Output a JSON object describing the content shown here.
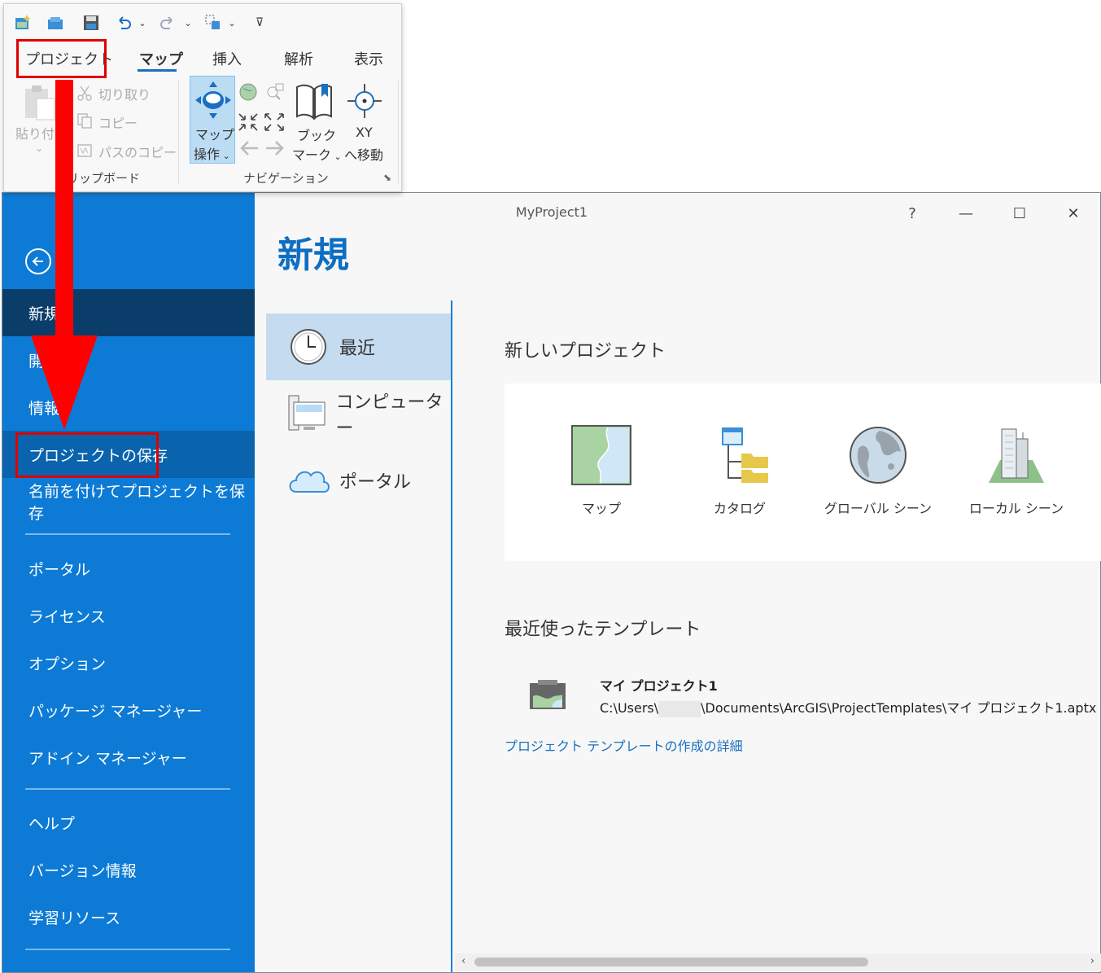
{
  "window": {
    "title": "MyProject1",
    "help": "?",
    "minimize": "—",
    "maximize": "☐",
    "close": "✕"
  },
  "heading": "新規",
  "sidebar": {
    "items": [
      {
        "label": "新規"
      },
      {
        "label": "開く"
      },
      {
        "label": "情報"
      },
      {
        "label": "プロジェクトの保存"
      },
      {
        "label": "名前を付けてプロジェクトを保存"
      },
      {
        "label": "ポータル"
      },
      {
        "label": "ライセンス"
      },
      {
        "label": "オプション"
      },
      {
        "label": "パッケージ マネージャー"
      },
      {
        "label": "アドイン マネージャー"
      },
      {
        "label": "ヘルプ"
      },
      {
        "label": "バージョン情報"
      },
      {
        "label": "学習リソース"
      }
    ]
  },
  "locations": [
    {
      "label": "最近",
      "icon": "clock-icon"
    },
    {
      "label": "コンピューター",
      "icon": "computer-icon"
    },
    {
      "label": "ポータル",
      "icon": "cloud-icon"
    }
  ],
  "new_project": {
    "title": "新しいプロジェクト",
    "items": [
      {
        "label": "マップ",
        "icon": "map-icon"
      },
      {
        "label": "カタログ",
        "icon": "catalog-icon"
      },
      {
        "label": "グローバル シーン",
        "icon": "globe-icon"
      },
      {
        "label": "ローカル シーン",
        "icon": "local-scene-icon"
      }
    ]
  },
  "templates": {
    "title": "最近使ったテンプレート",
    "items": [
      {
        "name": "マイ プロジェクト1",
        "path_before": "C:\\Users\\",
        "path_after": "\\Documents\\ArcGIS\\ProjectTemplates\\マイ プロジェクト1.aptx"
      }
    ],
    "link": "プロジェクト テンプレートの作成の詳細"
  },
  "ribbon": {
    "tabs": [
      "プロジェクト",
      "マップ",
      "挿入",
      "解析",
      "表示"
    ],
    "active_tab": "マップ",
    "clipboard": {
      "paste_label": "貼り付け",
      "cut_label": "切り取り",
      "copy_label": "コピー",
      "copy_path_label": "パスのコピー",
      "group_label": "クリップボード"
    },
    "navigation": {
      "explore_label_line1": "マップ",
      "explore_label_line2": "操作",
      "bookmark_label_line1": "ブック",
      "bookmark_label_line2": "マーク",
      "goto_xy_line1": "XY",
      "goto_xy_line2": "へ移動",
      "group_label": "ナビゲーション"
    }
  },
  "colors": {
    "sidebar_bg": "#0d7bd5",
    "sidebar_active": "#0b3d6b",
    "accent": "#1a6fc1",
    "highlight_red": "#e00000"
  }
}
